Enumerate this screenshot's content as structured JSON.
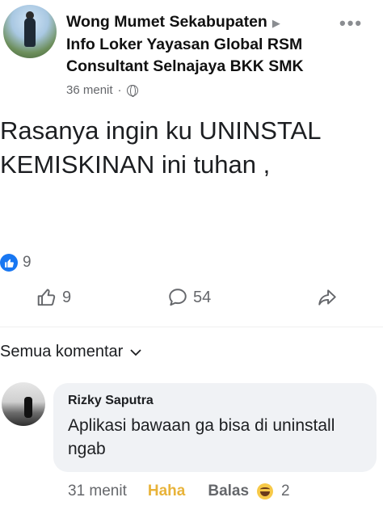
{
  "post": {
    "author_line1": "Wong Mumet Sekabupaten",
    "author_line2": "Info Loker Yayasan Global RSM",
    "author_line3": "Consultant Selnajaya BKK SMK",
    "time": "36 menit",
    "dot": "·",
    "more": "•••",
    "text_line1": "Rasanya ingin ku UNINSTAL",
    "text_line2": "KEMISKINAN ini tuhan ,",
    "reaction_count": "9"
  },
  "actions": {
    "like_count": "9",
    "comment_count": "54"
  },
  "comments_header": {
    "sort_label": "Semua komentar"
  },
  "comment": {
    "author": "Rizky Saputra",
    "text": "Aplikasi bawaan ga bisa di uninstall ngab",
    "time": "31 menit",
    "reaction_label": "Haha",
    "reply_label": "Balas",
    "reaction_count": "2"
  },
  "colors": {
    "accent": "#1877f2",
    "haha": "#e8b33a",
    "muted": "#65676b",
    "bubble": "#f0f2f5"
  }
}
